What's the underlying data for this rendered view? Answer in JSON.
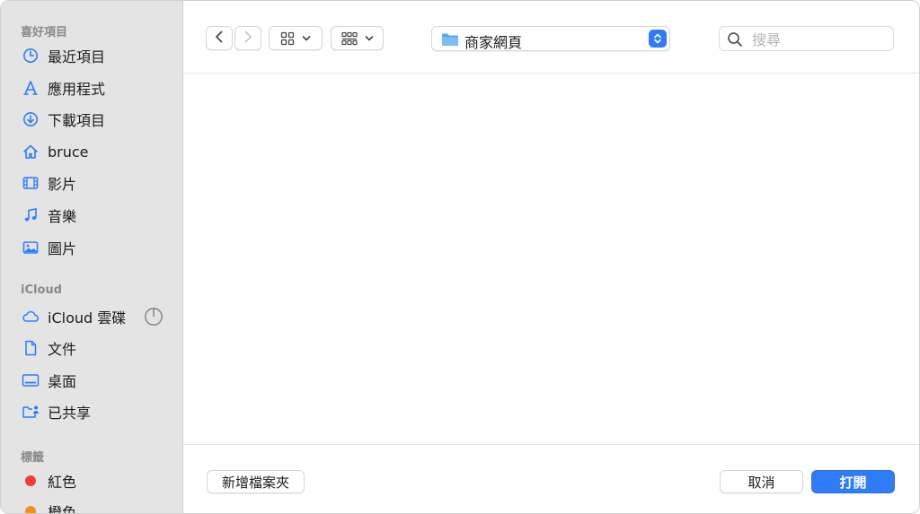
{
  "sidebar": {
    "favorites_title": "喜好項目",
    "favorites": [
      {
        "label": "最近項目",
        "icon": "clock-icon"
      },
      {
        "label": "應用程式",
        "icon": "apps-icon"
      },
      {
        "label": "下載項目",
        "icon": "download-icon"
      },
      {
        "label": "bruce",
        "icon": "home-icon"
      },
      {
        "label": "影片",
        "icon": "film-icon"
      },
      {
        "label": "音樂",
        "icon": "music-note-icon"
      },
      {
        "label": "圖片",
        "icon": "photo-icon"
      }
    ],
    "icloud_title": "iCloud",
    "icloud": [
      {
        "label": "iCloud 雲碟",
        "icon": "cloud-icon"
      },
      {
        "label": "文件",
        "icon": "document-icon"
      },
      {
        "label": "桌面",
        "icon": "desktop-icon"
      },
      {
        "label": "已共享",
        "icon": "shared-folder-icon"
      }
    ],
    "tags_title": "標籤",
    "tags": [
      {
        "label": "紅色",
        "color": "#f03c3c"
      },
      {
        "label": "橙色",
        "color": "#f0921e"
      }
    ]
  },
  "toolbar": {
    "current_folder": "商家網頁",
    "search_placeholder": "搜尋"
  },
  "footer": {
    "new_folder_label": "新增檔案夾",
    "cancel_label": "取消",
    "open_label": "打開"
  },
  "colors": {
    "accent": "#2f7cf6",
    "sidebar_bg": "#e4e4e4"
  }
}
